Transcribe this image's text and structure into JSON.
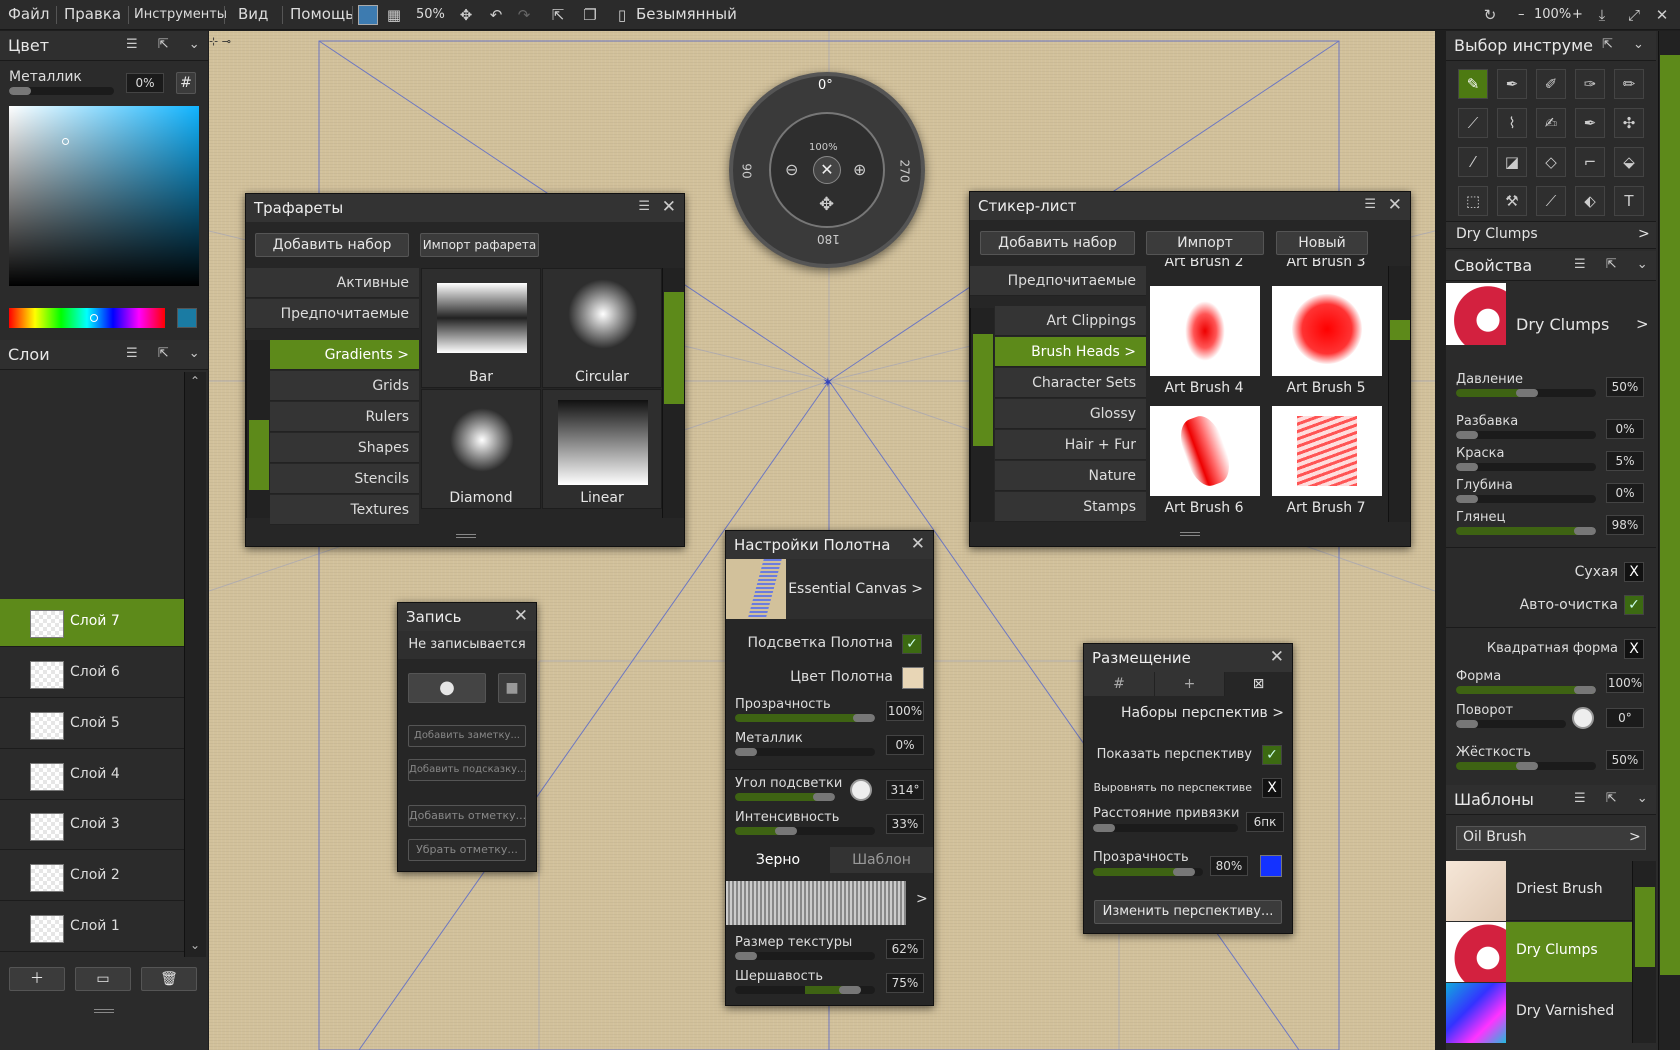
{
  "menu": {
    "file": "Файл",
    "edit": "Правка",
    "tools": "Инструменты",
    "view": "Вид",
    "help": "Помощь",
    "zoom": "50%",
    "doc": "Безымянный",
    "zoom_right": "100%"
  },
  "color": {
    "title": "Цвет",
    "metal_label": "Металлик",
    "metal_value": "0%",
    "hash": "#",
    "accent": "#5d8a1a"
  },
  "layers": {
    "title": "Слои",
    "items": [
      "Слой 7",
      "Слой 6",
      "Слой 5",
      "Слой 4",
      "Слой 3",
      "Слой 2",
      "Слой 1"
    ]
  },
  "stencils": {
    "title": "Трафареты",
    "add": "Добавить набор",
    "import": "Импорт рафарета",
    "cat_top": [
      "Активные",
      "Предпочитаемые"
    ],
    "cats": [
      "Gradients  >",
      "Grids",
      "Rulers",
      "Shapes",
      "Stencils",
      "Textures"
    ],
    "items": [
      "Bar",
      "Circular",
      "Diamond",
      "Linear"
    ]
  },
  "dial": {
    "top": "0°",
    "left": "90",
    "right": "270",
    "bottom": "180",
    "zoom": "100%"
  },
  "stickers": {
    "title": "Стикер-лист",
    "add": "Добавить набор",
    "import": "Импорт",
    "new": "Новый",
    "fav": "Предпочитаемые",
    "cats": [
      "Art Clippings",
      "Brush Heads  >",
      "Character Sets",
      "Glossy",
      "Hair + Fur",
      "Nature",
      "Stamps"
    ],
    "top_row": [
      "Art Brush 2",
      "Art Brush 3"
    ],
    "items": [
      "Art Brush 4",
      "Art Brush 5",
      "Art Brush 6",
      "Art Brush 7"
    ]
  },
  "record": {
    "title": "Запись",
    "status": "Не записывается",
    "btns": [
      "Добавить заметку...",
      "Добавить подсказку...",
      "Добавить отметку...",
      "Убрать отметку..."
    ]
  },
  "canvas_settings": {
    "title": "Настройки Полотна",
    "preset": "Essential Canvas  >",
    "highlight": "Подсветка Полотна",
    "canvas_color": "Цвет Полотна",
    "opacity": "Прозрачность",
    "opacity_val": "100%",
    "metal": "Металлик",
    "metal_val": "0%",
    "angle": "Угол подсветки",
    "angle_val": "314°",
    "intensity": "Интенсивность",
    "intensity_val": "33%",
    "tab_grain": "Зерно",
    "tab_pattern": "Шаблон",
    "tex_size": "Размер текстуры",
    "tex_size_val": "62%",
    "rough": "Шершавость",
    "rough_val": "75%"
  },
  "placement": {
    "title": "Размещение",
    "sets": "Наборы перспектив >",
    "show": "Показать перспективу",
    "align": "Выровнять по перспективе",
    "snap": "Расстояние привязки",
    "snap_val": "6пк",
    "opacity": "Прозрачность",
    "opacity_val": "80%",
    "change": "Изменить перспективу..."
  },
  "toolsel": {
    "title": "Выбор инструме",
    "current": "Dry Clumps"
  },
  "props": {
    "title": "Свойства",
    "brush": "Dry Clumps",
    "pressure": "Давление",
    "pressure_val": "50%",
    "thin": "Разбавка",
    "thin_val": "0%",
    "paint": "Краска",
    "paint_val": "5%",
    "depth": "Глубина",
    "depth_val": "0%",
    "gloss": "Глянец",
    "gloss_val": "98%",
    "dry": "Сухая",
    "autoclean": "Авто-очистка",
    "square": "Квадратная форма",
    "shape": "Форма",
    "shape_val": "100%",
    "rotation": "Поворот",
    "rotation_val": "0°",
    "hardness": "Жёсткость",
    "hardness_val": "50%"
  },
  "templates": {
    "title": "Шаблоны",
    "selected": "Oil Brush",
    "items": [
      "Driest Brush",
      "Dry Clumps",
      "Dry Varnished"
    ]
  }
}
